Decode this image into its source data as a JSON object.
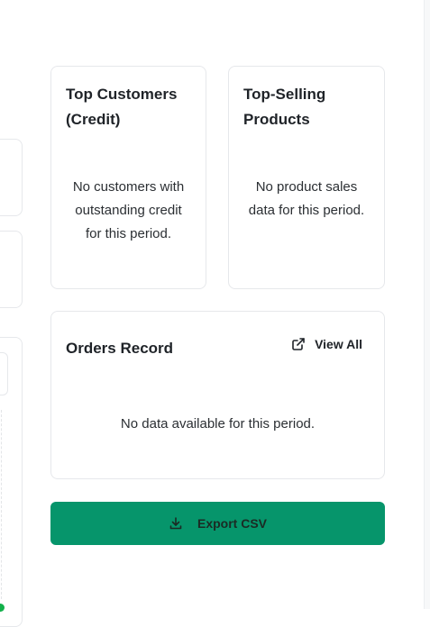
{
  "top_customers": {
    "title_line1": "Top Customers",
    "title_line2": "(Credit)",
    "empty_line1": "No customers with",
    "empty_line2": "outstanding credit",
    "empty_line3": "for this period."
  },
  "top_products": {
    "title_line1": "Top-Selling",
    "title_line2": "Products",
    "empty_line1": "No product sales",
    "empty_line2": "data for this period."
  },
  "orders_record": {
    "title": "Orders Record",
    "view_all_label": "View All",
    "view_all_icon": "external-link-icon",
    "empty_text": "No data available for this period."
  },
  "export": {
    "label": "Export CSV",
    "icon": "download-icon"
  },
  "colors": {
    "export_button": "#06956b",
    "status_dot": "#12b04a"
  }
}
